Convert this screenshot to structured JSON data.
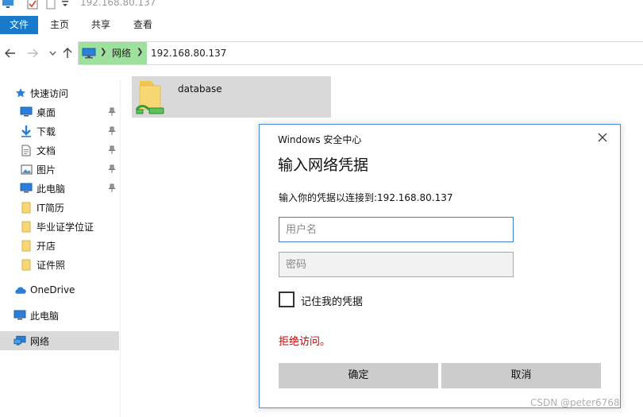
{
  "window": {
    "title": "192.168.80.137"
  },
  "ribbon": {
    "tabs": [
      {
        "label": "文件",
        "active": true
      },
      {
        "label": "主页"
      },
      {
        "label": "共享"
      },
      {
        "label": "查看"
      }
    ]
  },
  "address_bar": {
    "segments": [
      "网络",
      "192.168.80.137"
    ]
  },
  "sidebar": {
    "quick_access": "快速访问",
    "items": [
      {
        "label": "桌面",
        "pinned": true,
        "icon": "desktop-icon"
      },
      {
        "label": "下载",
        "pinned": true,
        "icon": "download-icon"
      },
      {
        "label": "文档",
        "pinned": true,
        "icon": "document-icon"
      },
      {
        "label": "图片",
        "pinned": true,
        "icon": "picture-icon"
      },
      {
        "label": "此电脑",
        "pinned": true,
        "icon": "computer-icon"
      },
      {
        "label": "IT简历",
        "icon": "folder-icon"
      },
      {
        "label": "毕业证学位证",
        "icon": "folder-icon"
      },
      {
        "label": "开店",
        "icon": "folder-icon"
      },
      {
        "label": "证件照",
        "icon": "folder-icon"
      }
    ],
    "onedrive": "OneDrive",
    "this_pc": "此电脑",
    "network": "网络"
  },
  "content": {
    "folders": [
      {
        "name": "database",
        "icon": "shared-folder-icon"
      }
    ]
  },
  "dialog": {
    "title": "Windows 安全中心",
    "heading": "输入网络凭据",
    "description": "输入你的凭据以连接到:192.168.80.137",
    "username_placeholder": "用户名",
    "password_placeholder": "密码",
    "remember_label": "记住我的凭据",
    "remember_checked": false,
    "error": "拒绝访问。",
    "ok_label": "确定",
    "cancel_label": "取消"
  },
  "watermark": "CSDN @peter6768",
  "colors": {
    "accent": "#1979ca",
    "address_highlight": "#9ee09e",
    "error": "#c40000",
    "selected_item": "#dadada"
  }
}
